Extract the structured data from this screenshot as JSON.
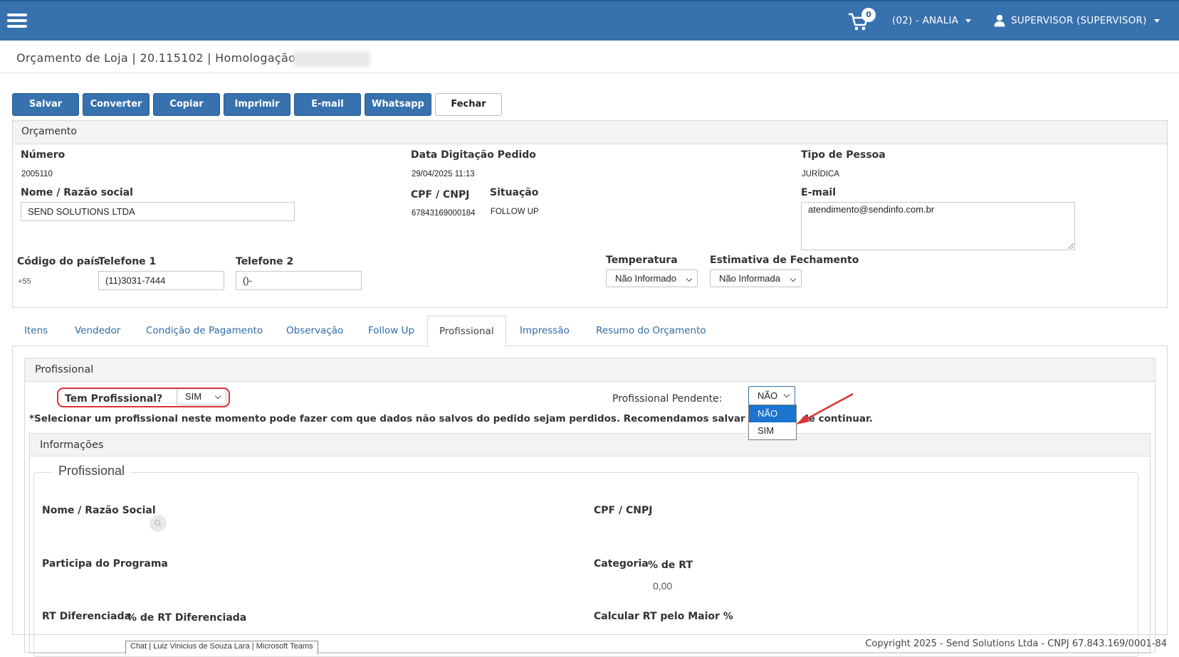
{
  "topbar": {
    "cart_count": "0",
    "store": "(02) - ANALIA",
    "user": "SUPERVISOR (SUPERVISOR)"
  },
  "header": {
    "title": "Orçamento de Loja | 20.115102 | Homologação |"
  },
  "toolbar": {
    "save": "Salvar",
    "convert": "Converter",
    "copy": "Copiar",
    "print": "Imprimir",
    "email": "E-mail",
    "whatsapp": "Whatsapp",
    "close": "Fechar"
  },
  "orcamento": {
    "panel_title": "Orçamento",
    "numero_label": "Número",
    "numero_value": "2005110",
    "data_label": "Data Digitação Pedido",
    "data_value": "29/04/2025 11:13",
    "tipo_label": "Tipo de Pessoa",
    "tipo_value": "JURÍDICA",
    "nome_label": "Nome / Razão social",
    "nome_value": "SEND SOLUTIONS LTDA",
    "cpf_label": "CPF / CNPJ",
    "cpf_value": "67843169000184",
    "situacao_label": "Situação",
    "situacao_value": "FOLLOW UP",
    "email_label": "E-mail",
    "email_value": "atendimento@sendinfo.com.br",
    "pais_label": "Código do país",
    "pais_value": "+55",
    "tel1_label": "Telefone 1",
    "tel1_value": "(11)3031-7444",
    "tel2_label": "Telefone 2",
    "tel2_value": "()-",
    "temp_label": "Temperatura",
    "temp_value": "Não Informado",
    "estim_label": "Estimativa de Fechamento",
    "estim_value": "Não Informada"
  },
  "tabs": [
    "Itens",
    "Vendedor",
    "Condição de Pagamento",
    "Observação",
    "Follow Up",
    "Profissional",
    "Impressão",
    "Resumo do Orçamento"
  ],
  "profissional": {
    "panel_title": "Profissional",
    "tem_label": "Tem Profissional?",
    "tem_value": "SIM",
    "pendente_label": "Profissional Pendente:",
    "pendente_value": "NÃO",
    "options": [
      "NÃO",
      "SIM"
    ],
    "warning": "*Selecionar um profissional neste momento pode fazer com que dados não salvos do pedido sejam perdidos. Recomendamos salvar o pe",
    "warning_end": "de continuar.",
    "info_title": "Informações",
    "legend": "Profissional",
    "nome_label": "Nome / Razão Social",
    "cpf_label": "CPF / CNPJ",
    "participa_label": "Participa do Programa",
    "categoria_label": "Categoria",
    "rt_label": "% de RT",
    "rt_value": "0,00",
    "rt_dif_label": "RT Diferenciada",
    "rt_dif_pct_label": "% de RT Diferenciada",
    "calc_label": "Calcular RT pelo Maior %"
  },
  "footer": {
    "chat": "Chat | Luiz Vinicius de Souza Lara | Microsoft Teams",
    "copyright": "Copyright 2025 - Send Solutions Ltda - CNPJ 67.843.169/0001-84"
  },
  "colors": {
    "primary": "#3771ae",
    "annotation_red": "#d9333b",
    "selection_blue": "#1b74d0"
  }
}
